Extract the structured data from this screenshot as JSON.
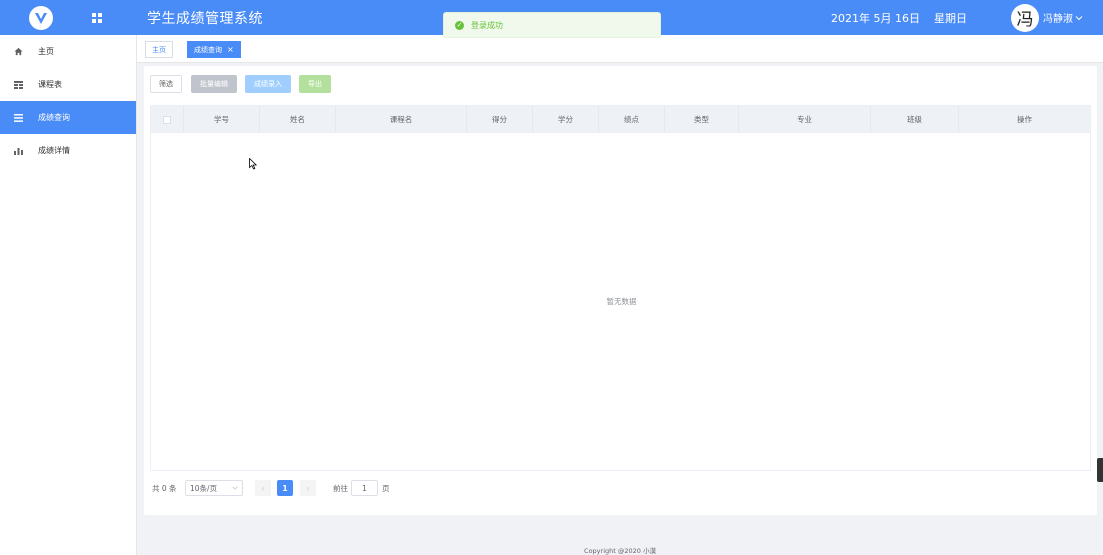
{
  "header": {
    "title": "学生成绩管理系统",
    "date": "2021年 5月 16日",
    "weekday": "星期日",
    "avatar_char": "冯",
    "username": "冯静淑",
    "logo_icon": "v-logo-icon",
    "menu_icon": "grid-icon",
    "brand_color": "#4a8cf7"
  },
  "toast": {
    "message": "登录成功",
    "color": "#67c23a"
  },
  "sidebar": {
    "items": [
      {
        "label": "主页",
        "icon": "home-icon"
      },
      {
        "label": "课程表",
        "icon": "table-icon"
      },
      {
        "label": "成绩查询",
        "icon": "list-icon",
        "active": true
      },
      {
        "label": "成绩详情",
        "icon": "bar-chart-icon"
      }
    ]
  },
  "tabs": [
    {
      "label": "主页"
    },
    {
      "label": "成绩查询",
      "closable": true,
      "active": true
    }
  ],
  "toolbar": {
    "filter": "筛选",
    "batch_edit": "批量编辑",
    "grade_entry": "成绩录入",
    "export": "导出"
  },
  "table": {
    "columns": [
      "学号",
      "姓名",
      "课程名",
      "得分",
      "学分",
      "绩点",
      "类型",
      "专业",
      "班级",
      "操作"
    ],
    "rows": [],
    "empty_text": "暂无数据"
  },
  "pagination": {
    "total_text": "共 0 条",
    "page_size": "10条/页",
    "current_page": "1",
    "goto_label": "前往",
    "goto_value": "1",
    "page_unit": "页"
  },
  "footer": {
    "copyright": "Copyright @2020 小漠"
  }
}
